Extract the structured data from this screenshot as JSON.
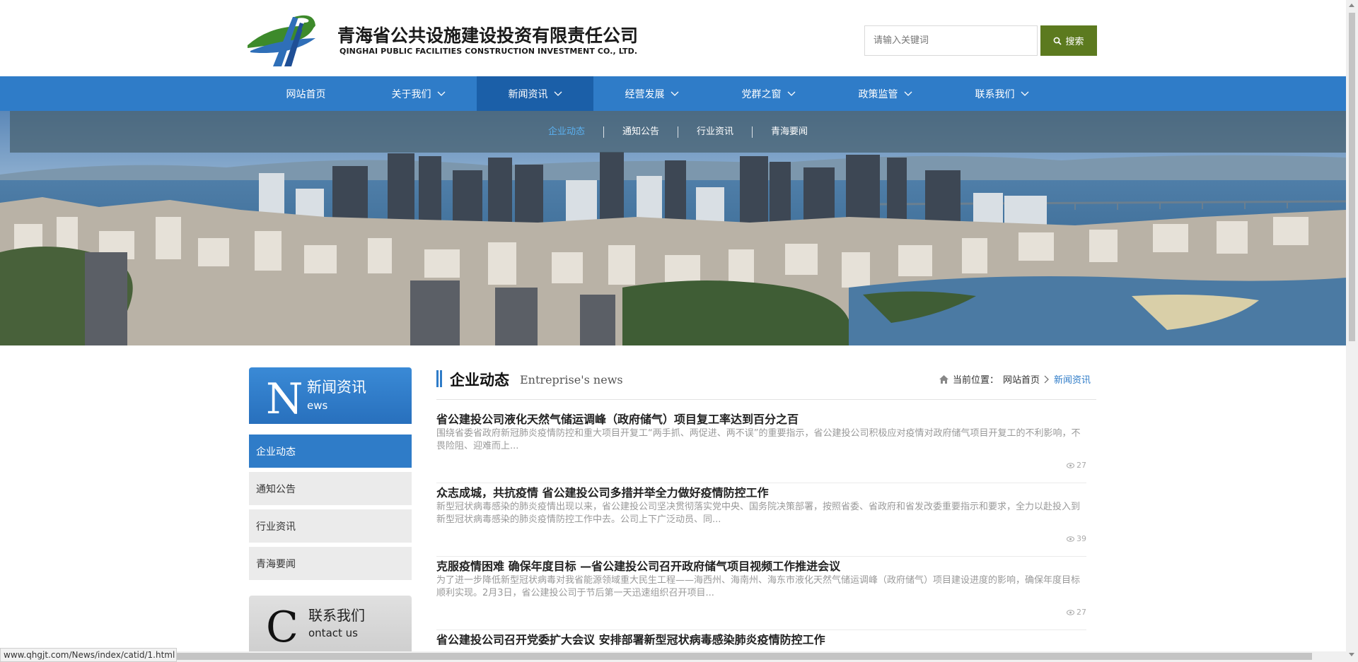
{
  "header": {
    "company_cn": "青海省公共设施建设投资有限责任公司",
    "company_en": "QINGHAI PUBLIC FACILITIES CONSTRUCTION INVESTMENT CO., LTD.",
    "search_placeholder": "请输入关键词",
    "search_button": "搜索"
  },
  "nav": {
    "items": [
      {
        "label": "网站首页"
      },
      {
        "label": "关于我们"
      },
      {
        "label": "新闻资讯"
      },
      {
        "label": "经营发展"
      },
      {
        "label": "党群之窗"
      },
      {
        "label": "政策监管"
      },
      {
        "label": "联系我们"
      }
    ],
    "active_index": 2
  },
  "subnav": {
    "items": [
      "企业动态",
      "通知公告",
      "行业资讯",
      "青海要闻"
    ],
    "active_index": 0
  },
  "sidebar": {
    "head_letter": "N",
    "head_title": "新闻资讯",
    "head_sub": "ews",
    "items": [
      "企业动态",
      "通知公告",
      "行业资讯",
      "青海要闻"
    ],
    "active_index": 0,
    "contact_letter": "C",
    "contact_title": "联系我们",
    "contact_sub": "ontact us"
  },
  "main": {
    "title": "企业动态",
    "subtitle": "Entreprise's news",
    "breadcrumb_label": "当前位置：",
    "breadcrumb_home": "网站首页",
    "breadcrumb_current": "新闻资讯",
    "news": [
      {
        "title": "省公建投公司液化天然气储运调峰（政府储气）项目复工率达到百分之百",
        "desc": "围绕省委省政府新冠肺炎疫情防控和重大项目开复工“两手抓、两促进、两不误”的重要指示，省公建投公司积极应对疫情对政府储气项目开复工的不利影响，不畏险阻、迎难而上...",
        "views": "27"
      },
      {
        "title": "众志成城，共抗疫情 省公建投公司多措并举全力做好疫情防控工作",
        "desc": "新型冠状病毒感染的肺炎疫情出现以来，省公建投公司坚决贯彻落实党中央、国务院决策部署，按照省委、省政府和省发改委重要指示和要求，全力以赴投入到新型冠状病毒感染的肺炎疫情防控工作中去。公司上下广泛动员、同...",
        "views": "39"
      },
      {
        "title": "克服疫情困难 确保年度目标 —省公建投公司召开政府储气项目视频工作推进会议",
        "desc": "为了进一步降低新型冠状病毒对我省能源领域重大民生工程——海西州、海南州、海东市液化天然气储运调峰（政府储气）项目建设进度的影响，确保年度目标顺利实现。2月3日，省公建投公司于节后第一天迅速组织召开项目...",
        "views": "27"
      },
      {
        "title": "省公建投公司召开党委扩大会议 安排部署新型冠状病毒感染肺炎疫情防控工作",
        "desc": "",
        "views": ""
      }
    ]
  },
  "statusbar": {
    "url": "www.qhgjt.com/News/index/catid/1.html"
  },
  "colors": {
    "nav_blue": "#2f7cc8",
    "nav_active": "#1b5fa8",
    "search_green": "#5c7a1f"
  }
}
